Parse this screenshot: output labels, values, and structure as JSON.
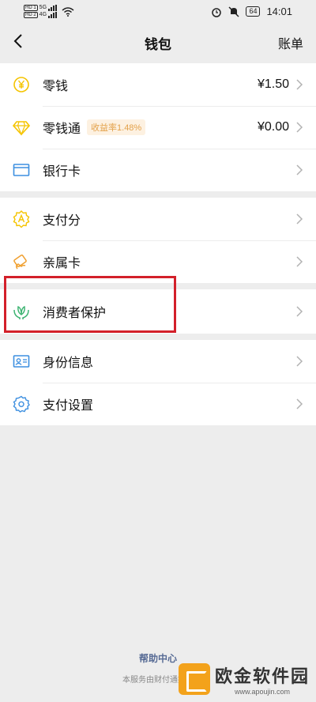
{
  "status": {
    "sim1_label": "HD 1",
    "sim1_net": "5G",
    "sim2_label": "HD 2",
    "sim2_net": "4G",
    "battery": "64",
    "time": "14:01"
  },
  "nav": {
    "title": "钱包",
    "right_label": "账单"
  },
  "groups": [
    [
      {
        "label": "零钱",
        "value": "¥1.50",
        "icon": "yuan-coin-icon",
        "color": "#f5c400"
      },
      {
        "label": "零钱通",
        "badge": "收益率1.48%",
        "value": "¥0.00",
        "icon": "diamond-icon",
        "color": "#f5c400"
      },
      {
        "label": "银行卡",
        "icon": "bank-card-icon",
        "color": "#3d8fe0"
      }
    ],
    [
      {
        "label": "支付分",
        "icon": "score-badge-icon",
        "color": "#f5c400"
      },
      {
        "label": "亲属卡",
        "icon": "family-card-icon",
        "color": "#f0a030"
      }
    ],
    [
      {
        "label": "消费者保护",
        "icon": "hands-leaf-icon",
        "color": "#3cb371"
      }
    ],
    [
      {
        "label": "身份信息",
        "icon": "id-card-icon",
        "color": "#3d8fe0"
      },
      {
        "label": "支付设置",
        "icon": "gear-icon",
        "color": "#3d8fe0"
      }
    ]
  ],
  "footer": {
    "help": "帮助中心",
    "note": "本服务由财付通提供"
  },
  "watermark": {
    "name": "欧金软件园",
    "url": "www.apoujin.com"
  }
}
